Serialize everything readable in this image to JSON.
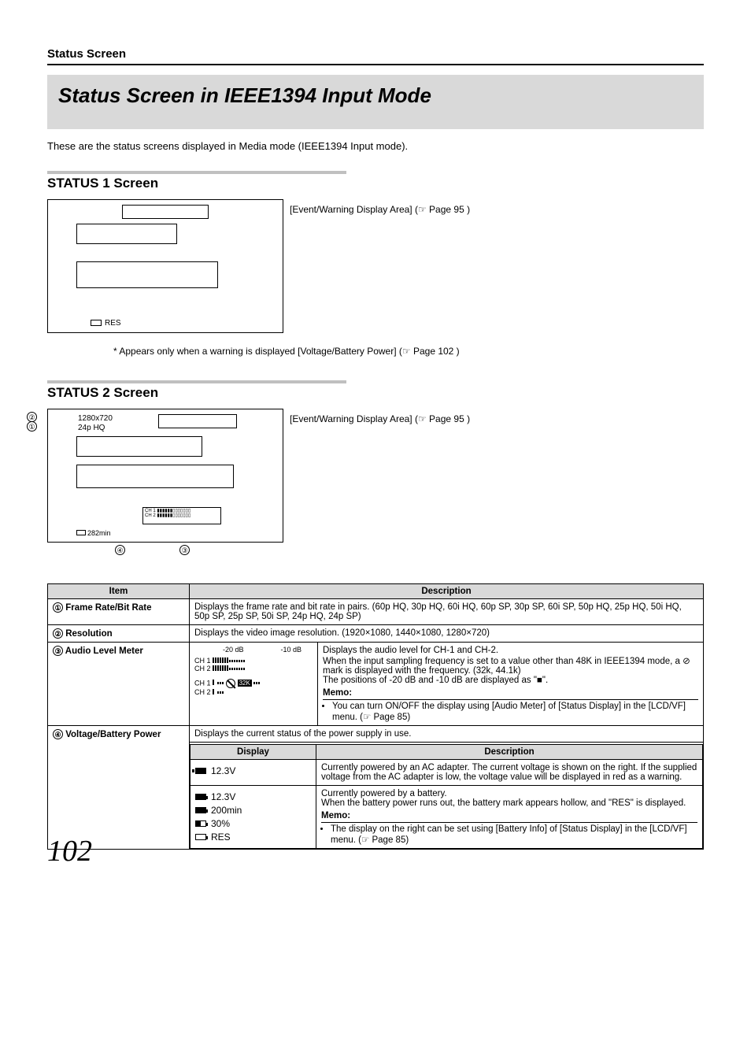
{
  "header_section": "Status Screen",
  "main_title": "Status Screen in IEEE1394 Input Mode",
  "lead_text": "These are the status screens displayed in Media mode (IEEE1394 Input mode).",
  "status1_title": "STATUS 1 Screen",
  "status1_callout": "[Event/Warning Display Area] (☞ Page 95 )",
  "status1_res": "RES",
  "status1_footnote": "* Appears only when a warning is displayed [Voltage/Battery Power] (☞ Page 102 )",
  "status2_title": "STATUS 2 Screen",
  "status2_callout": "[Event/Warning Display Area] (☞ Page 95 )",
  "status2_labels": {
    "resolution": "1280x720",
    "frame": "24p HQ",
    "remain": "282min"
  },
  "markers": {
    "m1": "①",
    "m2": "②",
    "m3": "③",
    "m4": "④"
  },
  "table": {
    "head_item": "Item",
    "head_desc": "Description",
    "row1_item": "Frame Rate/Bit Rate",
    "row1_desc": "Displays the frame rate and bit rate in pairs. (60p HQ, 30p HQ, 60i HQ, 60p SP, 30p SP, 60i SP, 50p HQ, 25p HQ, 50i HQ, 50p SP, 25p SP, 50i SP, 24p HQ, 24p SP)",
    "row2_item": "Resolution",
    "row2_desc": "Displays the video image resolution. (1920×1080, 1440×1080, 1280×720)",
    "row3_item": "Audio Level Meter",
    "row3_desc_main": "Displays the audio level for CH-1 and CH-2.\nWhen the input sampling frequency is set to a value other than 48K in IEEE1394 mode, a ⊘ mark is displayed with the frequency. (32k, 44.1k)\nThe positions of -20 dB and -10 dB are displayed as \"■\".",
    "row3_memo_label": "Memo:",
    "row3_memo": "You can turn ON/OFF the display using [Audio Meter] of [Status Display] in the [LCD/VF] menu. (☞ Page 85)",
    "row4_item": "Voltage/Battery Power",
    "row4_lead": "Displays the current status of the power supply in use.",
    "row4_disp_head": "Display",
    "row4_desc_head": "Description",
    "row4_d1": "12.3V",
    "row4_d1_desc": "Currently powered by an AC adapter. The current voltage is shown on the right. If the supplied voltage from the AC adapter is low, the voltage value will be displayed in red as a warning.",
    "row4_d2a": "12.3V",
    "row4_d2b": "200min",
    "row4_d2c": "30%",
    "row4_d2d": "RES",
    "row4_d2_desc": "Currently powered by a battery.\nWhen the battery power runs out, the battery mark appears hollow, and \"RES\" is displayed.",
    "row4_memo_label": "Memo:",
    "row4_memo": "The display on the right can be set using [Battery Info] of [Status Display] in the [LCD/VF] menu. (☞ Page 85)"
  },
  "meter": {
    "neg20": "-20 dB",
    "neg10": "-10 dB",
    "ch1": "CH 1",
    "ch2": "CH 2",
    "k32": "32K"
  },
  "page_number": "102"
}
